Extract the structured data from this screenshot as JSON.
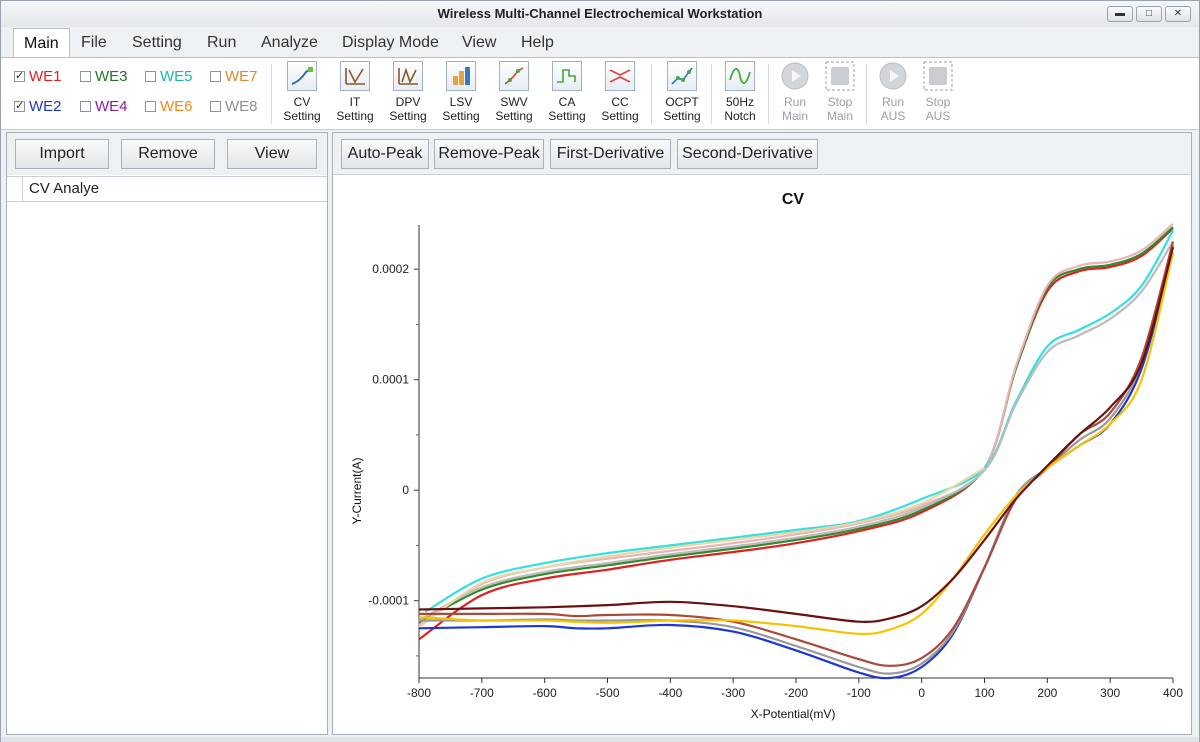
{
  "window": {
    "title": "Wireless Multi-Channel Electrochemical Workstation",
    "buttons": {
      "minimize": "▬",
      "maximize": "□",
      "close": "✕"
    }
  },
  "menu": {
    "items": [
      "Main",
      "File",
      "Setting",
      "Run",
      "Analyze",
      "Display Mode",
      "View",
      "Help"
    ],
    "active": "Main"
  },
  "electrodes": [
    {
      "label": "WE1",
      "checked": true,
      "color": "#e02020"
    },
    {
      "label": "WE2",
      "checked": true,
      "color": "#1f36d6"
    },
    {
      "label": "WE3",
      "checked": false,
      "color": "#247324"
    },
    {
      "label": "WE4",
      "checked": false,
      "color": "#8b1da3"
    },
    {
      "label": "WE5",
      "checked": false,
      "color": "#19b3b3"
    },
    {
      "label": "WE6",
      "checked": false,
      "color": "#f08a1c"
    },
    {
      "label": "WE7",
      "checked": false,
      "color": "#d98a2c"
    },
    {
      "label": "WE8",
      "checked": false,
      "color": "#909090"
    }
  ],
  "toolbar": {
    "tools": [
      {
        "line1": "CV",
        "line2": "Setting",
        "icon": "cv-setting-icon",
        "enabled": true
      },
      {
        "line1": "IT",
        "line2": "Setting",
        "icon": "it-setting-icon",
        "enabled": true
      },
      {
        "line1": "DPV",
        "line2": "Setting",
        "icon": "dpv-setting-icon",
        "enabled": true
      },
      {
        "line1": "LSV",
        "line2": "Setting",
        "icon": "lsv-setting-icon",
        "enabled": true
      },
      {
        "line1": "SWV",
        "line2": "Setting",
        "icon": "swv-setting-icon",
        "enabled": true
      },
      {
        "line1": "CA",
        "line2": "Setting",
        "icon": "ca-setting-icon",
        "enabled": true
      },
      {
        "line1": "CC",
        "line2": "Setting",
        "icon": "cc-setting-icon",
        "enabled": true
      },
      {
        "line1": "OCPT",
        "line2": "Setting",
        "icon": "ocpt-setting-icon",
        "enabled": true
      },
      {
        "line1": "50Hz",
        "line2": "Notch",
        "icon": "notch-icon",
        "enabled": true
      },
      {
        "line1": "Run",
        "line2": "Main",
        "icon": "play-icon",
        "enabled": false
      },
      {
        "line1": "Stop",
        "line2": "Main",
        "icon": "stop-icon",
        "enabled": false
      },
      {
        "line1": "Run",
        "line2": "AUS",
        "icon": "play-icon",
        "enabled": false
      },
      {
        "line1": "Stop",
        "line2": "AUS",
        "icon": "stop-icon",
        "enabled": false
      }
    ]
  },
  "left_panel": {
    "buttons": [
      "Import",
      "Remove",
      "View"
    ],
    "list_header": "CV Analye"
  },
  "right_panel": {
    "buttons": [
      "Auto-Peak",
      "Remove-Peak",
      "First-Derivative",
      "Second-Derivative"
    ]
  },
  "chart_data": {
    "type": "line",
    "title": "CV",
    "xlabel": "X-Potential(mV)",
    "ylabel": "Y-Current(A)",
    "xlim": [
      -800,
      400
    ],
    "ylim": [
      -0.00017,
      0.00024
    ],
    "xticks": [
      -800,
      -700,
      -600,
      -500,
      -400,
      -300,
      -200,
      -100,
      0,
      100,
      200,
      300,
      400
    ],
    "yticks": [
      {
        "value": -0.0001,
        "label": "-0.0001"
      },
      {
        "value": 0,
        "label": "0"
      },
      {
        "value": 0.0001,
        "label": "0.0001"
      },
      {
        "value": 0.0002,
        "label": "0.0002"
      }
    ],
    "grid": false,
    "series": [
      {
        "color": "#e02020",
        "x": [
          -800,
          -700,
          -600,
          -500,
          -400,
          -300,
          -200,
          -100,
          0,
          100,
          150,
          200,
          250,
          300,
          350,
          400
        ],
        "y": [
          -0.000135,
          -9.5e-05,
          -8e-05,
          -7.2e-05,
          -6.3e-05,
          -5.6e-05,
          -4.8e-05,
          -3.7e-05,
          -2e-05,
          2e-05,
          0.00011,
          0.00018,
          0.000198,
          0.000202,
          0.000212,
          0.000237
        ]
      },
      {
        "color": "#2e8b2e",
        "x": [
          -800,
          -700,
          -600,
          -500,
          -400,
          -300,
          -200,
          -100,
          0,
          100,
          150,
          200,
          250,
          300,
          350,
          400
        ],
        "y": [
          -0.00012,
          -9e-05,
          -7.6e-05,
          -6.8e-05,
          -6e-05,
          -5.3e-05,
          -4.5e-05,
          -3.5e-05,
          -1.8e-05,
          2e-05,
          0.00011,
          0.000183,
          0.0002,
          0.000204,
          0.000214,
          0.000238
        ]
      },
      {
        "color": "#e8b4b4",
        "x": [
          -800,
          -700,
          -600,
          -500,
          -400,
          -300,
          -200,
          -100,
          0,
          100,
          150,
          200,
          250,
          300,
          350,
          400
        ],
        "y": [
          -0.000122,
          -8.5e-05,
          -7e-05,
          -6.2e-05,
          -5.5e-05,
          -4.8e-05,
          -4e-05,
          -3e-05,
          -1.4e-05,
          2e-05,
          0.000112,
          0.000185,
          0.000203,
          0.000207,
          0.000217,
          0.000241
        ]
      },
      {
        "color": "#33e0e0",
        "x": [
          -790,
          -700,
          -600,
          -500,
          -400,
          -300,
          -200,
          -100,
          0,
          100,
          150,
          200,
          250,
          300,
          350,
          400
        ],
        "y": [
          -0.00011,
          -8e-05,
          -6.6e-05,
          -5.7e-05,
          -5e-05,
          -4.3e-05,
          -3.6e-05,
          -2.8e-05,
          -8e-06,
          2e-05,
          8e-05,
          0.00013,
          0.000145,
          0.00016,
          0.000185,
          0.000235
        ]
      },
      {
        "color": "#bbbbbb",
        "x": [
          -800,
          -700,
          -600,
          -500,
          -400,
          -300,
          -200,
          -100,
          0,
          100,
          150,
          200,
          250,
          300,
          350,
          400
        ],
        "y": [
          -0.000118,
          -8.8e-05,
          -7.4e-05,
          -6.6e-05,
          -5.8e-05,
          -5.1e-05,
          -4.3e-05,
          -3.3e-05,
          -1.6e-05,
          1.8e-05,
          7.8e-05,
          0.000125,
          0.00014,
          0.000155,
          0.00018,
          0.000225
        ]
      },
      {
        "color": "#e8d7a8",
        "x": [
          -800,
          -700,
          -600,
          -500,
          -400,
          -300,
          -200,
          -100,
          0,
          100
        ],
        "y": [
          -0.000124,
          -8.4e-05,
          -7e-05,
          -6e-05,
          -5.2e-05,
          -4.5e-05,
          -3.8e-05,
          -2.9e-05,
          -1.2e-05,
          2e-05
        ]
      },
      {
        "color": "#1f36d6",
        "x": [
          -800,
          -700,
          -600,
          -550,
          -500,
          -400,
          -300,
          -200,
          -100,
          -50,
          0,
          50,
          100,
          150,
          200,
          250,
          300,
          350,
          400
        ],
        "y": [
          -0.000125,
          -0.000124,
          -0.000123,
          -0.000125,
          -0.000125,
          -0.000122,
          -0.000128,
          -0.000145,
          -0.000165,
          -0.00017,
          -0.00016,
          -0.00013,
          -7e-05,
          -5e-06,
          2e-05,
          4e-05,
          6e-05,
          0.00011,
          0.000215
        ]
      },
      {
        "color": "#999999",
        "x": [
          -800,
          -700,
          -600,
          -550,
          -500,
          -400,
          -300,
          -200,
          -100,
          -50,
          0,
          50,
          100,
          150,
          200,
          250,
          300,
          350,
          400
        ],
        "y": [
          -0.000118,
          -0.000118,
          -0.000117,
          -0.000118,
          -0.000118,
          -0.000118,
          -0.000124,
          -0.000141,
          -0.00016,
          -0.000166,
          -0.000157,
          -0.000128,
          -7e-05,
          -5e-06,
          2e-05,
          4.5e-05,
          6.5e-05,
          0.000115,
          0.000222
        ]
      },
      {
        "color": "#a94a3a",
        "x": [
          -800,
          -700,
          -600,
          -550,
          -500,
          -400,
          -300,
          -200,
          -100,
          -50,
          0,
          50,
          100,
          150,
          200,
          250,
          300,
          350,
          400
        ],
        "y": [
          -0.000112,
          -0.000112,
          -0.000112,
          -0.000114,
          -0.000113,
          -0.000113,
          -0.000119,
          -0.000135,
          -0.000153,
          -0.000159,
          -0.000152,
          -0.000125,
          -7e-05,
          -8e-06,
          2e-05,
          5e-05,
          7e-05,
          0.00012,
          0.000225
        ]
      },
      {
        "color": "#f5c400",
        "x": [
          -800,
          -700,
          -600,
          -500,
          -400,
          -300,
          -200,
          -100,
          -50,
          0,
          50,
          100,
          150,
          200,
          250,
          300,
          350,
          400
        ],
        "y": [
          -0.000115,
          -0.000118,
          -0.000118,
          -0.00012,
          -0.000118,
          -0.000118,
          -0.000123,
          -0.00013,
          -0.000126,
          -0.000112,
          -8e-05,
          -4e-05,
          -5e-06,
          2e-05,
          4e-05,
          6e-05,
          0.0001,
          0.000215
        ]
      },
      {
        "color": "#6b0f0f",
        "x": [
          -800,
          -700,
          -600,
          -500,
          -400,
          -300,
          -200,
          -100,
          -50,
          0,
          50,
          100,
          150,
          200,
          250,
          300,
          350,
          400
        ],
        "y": [
          -0.000108,
          -0.000107,
          -0.000106,
          -0.000104,
          -0.000101,
          -0.000105,
          -0.000112,
          -0.000119,
          -0.000116,
          -0.000105,
          -8e-05,
          -4.5e-05,
          -8e-06,
          2.2e-05,
          5e-05,
          7.5e-05,
          0.000115,
          0.00022
        ]
      }
    ]
  }
}
